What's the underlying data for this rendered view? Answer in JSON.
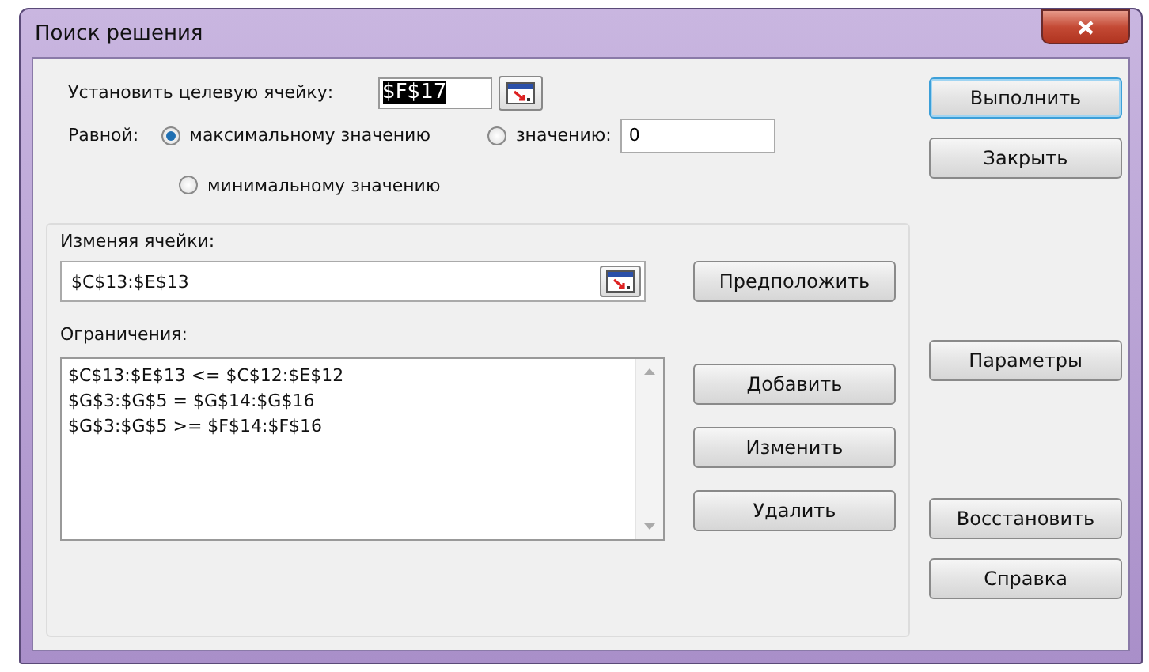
{
  "window": {
    "title": "Поиск решения"
  },
  "target_cell": {
    "label": "Установить целевую ячейку:",
    "value": "$F$17",
    "highlighted": true
  },
  "equal_to": {
    "label": "Равной:",
    "options": [
      {
        "label": "максимальному значению",
        "selected": true
      },
      {
        "label": "значению:",
        "selected": false,
        "value": "0"
      },
      {
        "label": "минимальному значению",
        "selected": false
      }
    ]
  },
  "changing_cells": {
    "label": "Изменяя ячейки:",
    "value": "$C$13:$E$13",
    "button": "Предположить"
  },
  "constraints": {
    "label": "Ограничения:",
    "items": [
      "$C$13:$E$13 <= $C$12:$E$12",
      "$G$3:$G$5 = $G$14:$G$16",
      "$G$3:$G$5 >= $F$14:$F$16"
    ],
    "buttons": [
      "Добавить",
      "Изменить",
      "Удалить"
    ]
  },
  "buttons": [
    {
      "label": "Выполнить",
      "default": true
    },
    {
      "label": "Закрыть",
      "default": false
    },
    {
      "label": "Параметры",
      "default": false
    },
    {
      "label": "Восстановить",
      "default": false
    },
    {
      "label": "Справка",
      "default": false
    }
  ]
}
